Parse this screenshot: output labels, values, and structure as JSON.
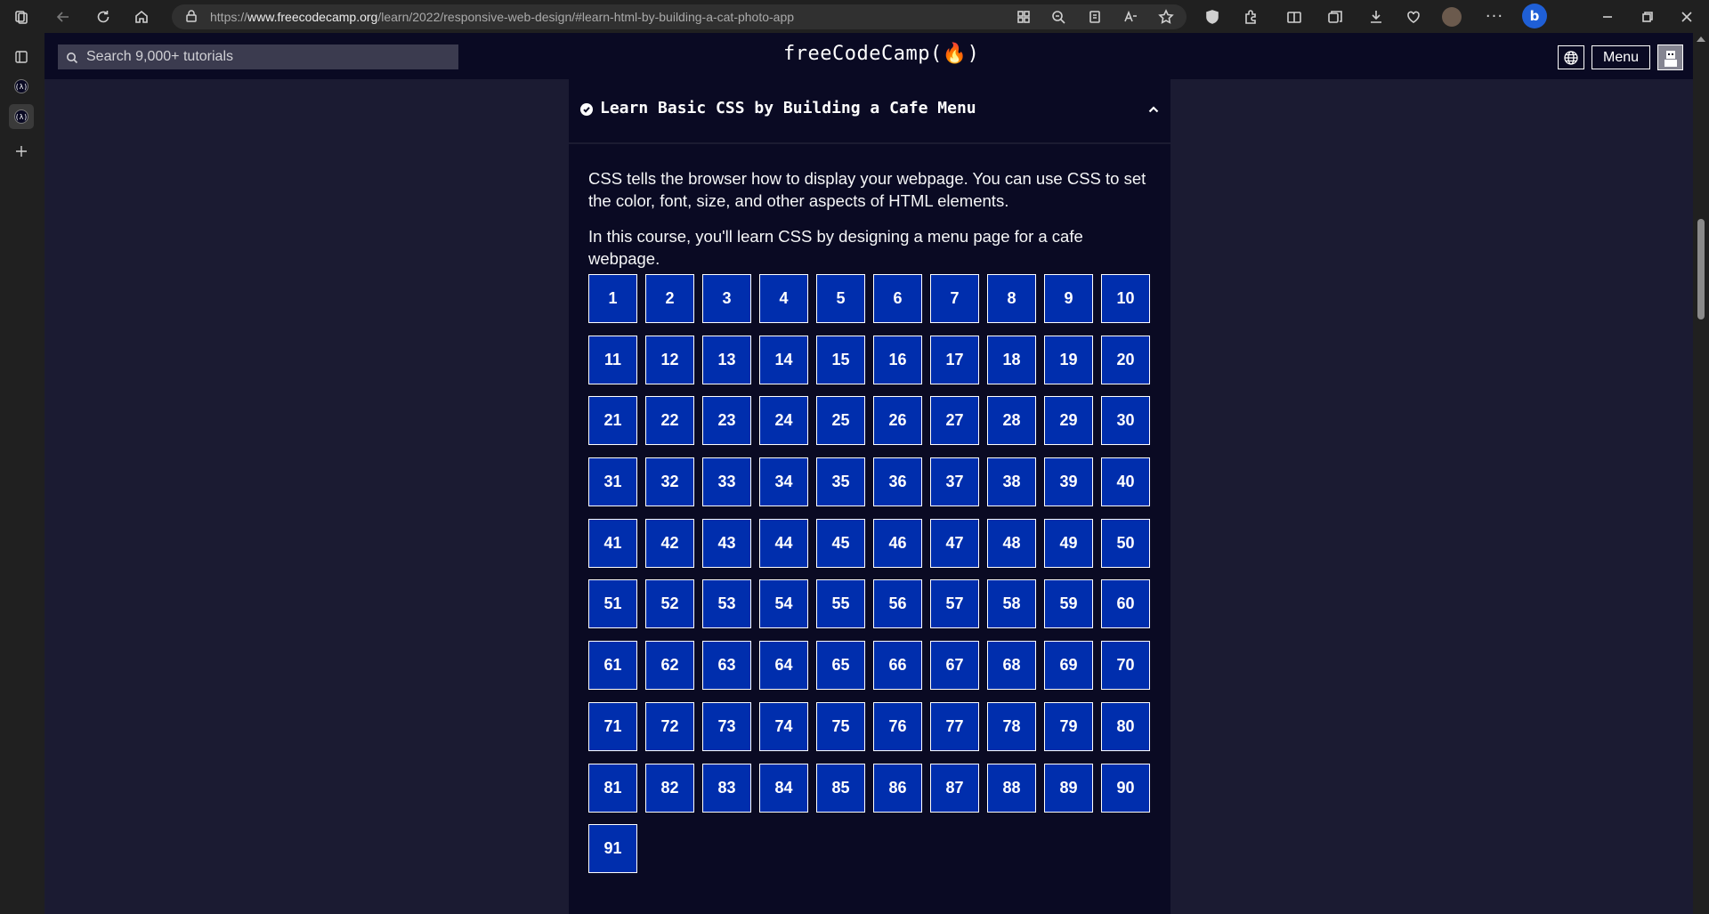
{
  "browser": {
    "url_prefix": "https://",
    "url_domain": "www.freecodecamp.org",
    "url_path": "/learn/2022/responsive-web-design/#learn-html-by-building-a-cat-photo-app"
  },
  "site_nav": {
    "search_placeholder": "Search 9,000+ tutorials",
    "logo_text": "freeCodeCamp(🔥)",
    "menu_label": "Menu"
  },
  "block": {
    "title": "Learn Basic CSS by Building a Cafe Menu",
    "description_1": "CSS tells the browser how to display your webpage. You can use CSS to set the color, font, size, and other aspects of HTML elements.",
    "description_2": "In this course, you'll learn CSS by designing a menu page for a cafe webpage.",
    "steps": [
      "1",
      "2",
      "3",
      "4",
      "5",
      "6",
      "7",
      "8",
      "9",
      "10",
      "11",
      "12",
      "13",
      "14",
      "15",
      "16",
      "17",
      "18",
      "19",
      "20",
      "21",
      "22",
      "23",
      "24",
      "25",
      "26",
      "27",
      "28",
      "29",
      "30",
      "31",
      "32",
      "33",
      "34",
      "35",
      "36",
      "37",
      "38",
      "39",
      "40",
      "41",
      "42",
      "43",
      "44",
      "45",
      "46",
      "47",
      "48",
      "49",
      "50",
      "51",
      "52",
      "53",
      "54",
      "55",
      "56",
      "57",
      "58",
      "59",
      "60",
      "61",
      "62",
      "63",
      "64",
      "65",
      "66",
      "67",
      "68",
      "69",
      "70",
      "71",
      "72",
      "73",
      "74",
      "75",
      "76",
      "77",
      "78",
      "79",
      "80",
      "81",
      "82",
      "83",
      "84",
      "85",
      "86",
      "87",
      "88",
      "89",
      "90",
      "91"
    ]
  },
  "colors": {
    "nav_bg": "#0a0a23",
    "page_bg": "#1b1b32",
    "step_bg": "#002ead"
  }
}
